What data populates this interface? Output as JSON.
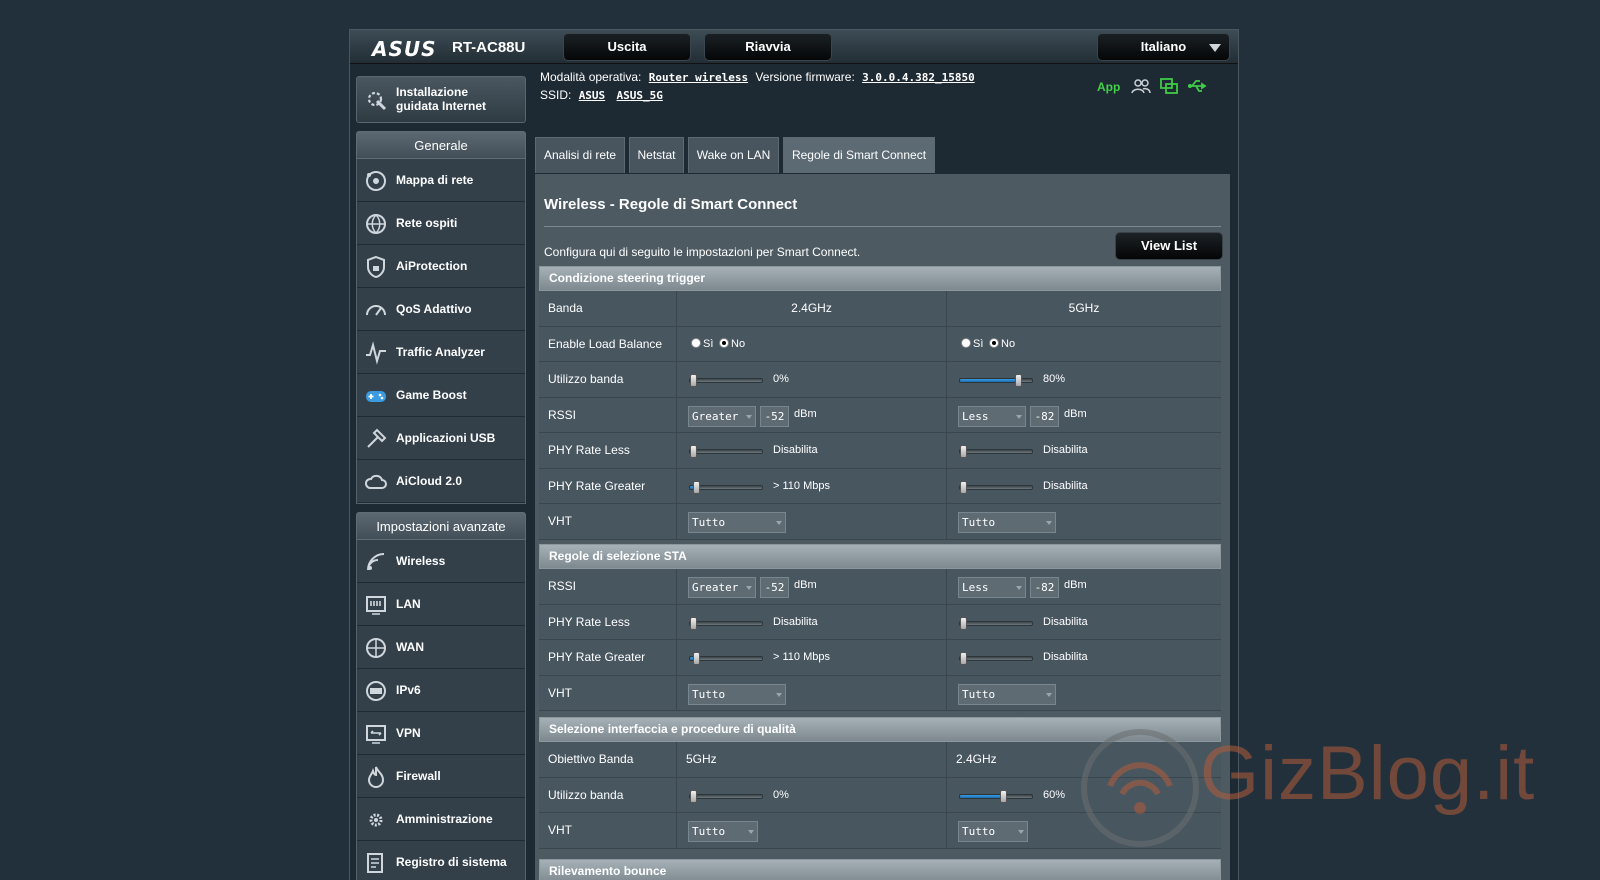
{
  "header": {
    "brand": "ASUS",
    "model": "RT-AC88U",
    "logout_label": "Uscita",
    "reboot_label": "Riavvia",
    "language": "Italiano"
  },
  "status": {
    "mode_label": "Modalità operativa:",
    "mode_value": "Router wireless",
    "firmware_label": "Versione firmware:",
    "firmware_value": "3.0.0.4.382_15850",
    "ssid_label": "SSID:",
    "ssid_1": "ASUS",
    "ssid_2": "ASUS_5G",
    "app_label": "App",
    "icons": [
      "users-icon",
      "network-icon",
      "usb-icon"
    ]
  },
  "sidebar": {
    "wizard_label_1": "Installazione",
    "wizard_label_2": "guidata Internet",
    "general_title": "Generale",
    "general_items": [
      {
        "label": "Mappa di rete",
        "icon": "network-map-icon"
      },
      {
        "label": "Rete ospiti",
        "icon": "guest-network-icon"
      },
      {
        "label": "AiProtection",
        "icon": "lock-icon"
      },
      {
        "label": "QoS Adattivo",
        "icon": "gauge-icon"
      },
      {
        "label": "Traffic Analyzer",
        "icon": "analyzer-icon"
      },
      {
        "label": "Game Boost",
        "icon": "gamepad-icon"
      },
      {
        "label": "Applicazioni USB",
        "icon": "usb-app-icon"
      },
      {
        "label": "AiCloud 2.0",
        "icon": "cloud-icon"
      }
    ],
    "advanced_title": "Impostazioni avanzate",
    "advanced_items": [
      {
        "label": "Wireless",
        "icon": "wifi-icon"
      },
      {
        "label": "LAN",
        "icon": "lan-icon"
      },
      {
        "label": "WAN",
        "icon": "globe-icon"
      },
      {
        "label": "IPv6",
        "icon": "ipv6-icon"
      },
      {
        "label": "VPN",
        "icon": "vpn-icon"
      },
      {
        "label": "Firewall",
        "icon": "fire-icon"
      },
      {
        "label": "Amministrazione",
        "icon": "gear-icon"
      },
      {
        "label": "Registro di sistema",
        "icon": "log-icon"
      }
    ]
  },
  "tabs": [
    "Analisi di rete",
    "Netstat",
    "Wake on LAN",
    "Regole di Smart Connect"
  ],
  "active_tab": "Regole di Smart Connect",
  "panel": {
    "title": "Wireless - Regole di Smart Connect",
    "description": "Configura qui di seguito le impostazioni per Smart Connect.",
    "view_list_label": "View List"
  },
  "steering": {
    "title": "Condizione steering trigger",
    "band_label": "Banda",
    "band_24": "2.4GHz",
    "band_5": "5GHz",
    "load_balance_label": "Enable Load Balance",
    "yes": "Sì",
    "no": "No",
    "lb_24": "No",
    "lb_5": "No",
    "util_label": "Utilizzo banda",
    "util_24": "0%",
    "util_24_value": 0,
    "util_5": "80%",
    "util_5_value": 80,
    "rssi_label": "RSSI",
    "rssi_24_op": "Greater",
    "rssi_24_val": "-52",
    "rssi_5_op": "Less",
    "rssi_5_val": "-82",
    "unit": "dBm",
    "phy_less_label": "PHY Rate Less",
    "phy_less_24": "Disabilita",
    "phy_less_24_value": 0,
    "phy_less_5": "Disabilita",
    "phy_less_5_value": 0,
    "phy_greater_label": "PHY Rate Greater",
    "phy_greater_24": "> 110 Mbps",
    "phy_greater_24_value": 8,
    "phy_greater_5": "Disabilita",
    "phy_greater_5_value": 0,
    "vht_label": "VHT",
    "vht_24": "Tutto",
    "vht_5": "Tutto"
  },
  "sta": {
    "title": "Regole di selezione STA",
    "rssi_label": "RSSI",
    "rssi_24_op": "Greater",
    "rssi_24_val": "-52",
    "rssi_5_op": "Less",
    "rssi_5_val": "-82",
    "unit": "dBm",
    "phy_less_label": "PHY Rate Less",
    "phy_less_24": "Disabilita",
    "phy_less_5": "Disabilita",
    "phy_greater_label": "PHY Rate Greater",
    "phy_greater_24": "> 110 Mbps",
    "phy_greater_5": "Disabilita",
    "vht_label": "VHT",
    "vht_24": "Tutto",
    "vht_5": "Tutto"
  },
  "interface": {
    "title": "Selezione interfaccia e procedure di qualità",
    "target_label": "Obiettivo Banda",
    "target_24": "5GHz",
    "target_5": "2.4GHz",
    "util_label": "Utilizzo banda",
    "util_24": "0%",
    "util_24_value": 0,
    "util_5": "60%",
    "util_5_value": 60,
    "vht_label": "VHT",
    "vht_24": "Tutto",
    "vht_5": "Tutto"
  },
  "bounce": {
    "title": "Rilevamento bounce"
  },
  "watermark": "GizBlog.it"
}
